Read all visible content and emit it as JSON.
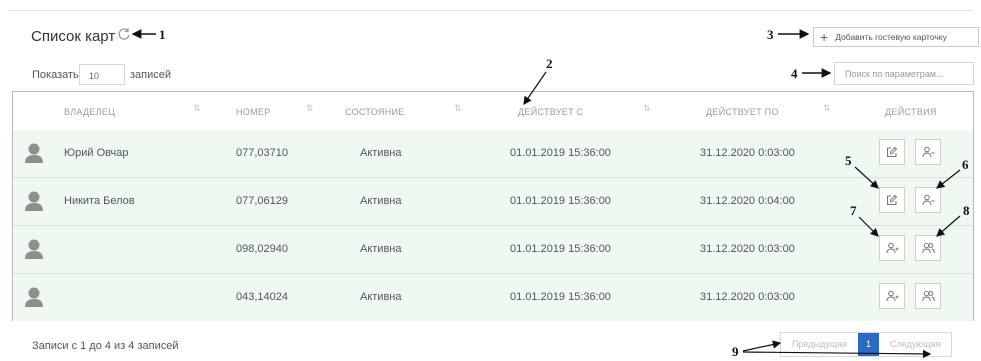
{
  "header": {
    "title": "Список карт",
    "refresh_icon": "refresh-icon",
    "add_button_label": "Добавить гостевую карточку"
  },
  "controls": {
    "show_label": "Показать",
    "length_value": "10",
    "records_label": "записей",
    "search_placeholder": "Поиск по параметрам..."
  },
  "table": {
    "columns": [
      "ВЛАДЕЛЕЦ",
      "НОМЕР",
      "СОСТОЯНИЕ",
      "ДЕЙСТВУЕТ С",
      "ДЕЙСТВУЕТ ПО",
      "ДЕЙСТВИЯ"
    ],
    "rows": [
      {
        "owner": "Юрий Овчар",
        "number": "077,03710",
        "status": "Активна",
        "from": "01.01.2019 15:36:00",
        "to": "31.12.2020 0:03:00",
        "actions": [
          "edit-icon",
          "remove-user-icon"
        ]
      },
      {
        "owner": "Никита Белов",
        "number": "077,06129",
        "status": "Активна",
        "from": "01.01.2019 15:36:00",
        "to": "31.12.2020 0:04:00",
        "actions": [
          "edit-icon",
          "remove-user-icon"
        ]
      },
      {
        "owner": "",
        "number": "098,02940",
        "status": "Активна",
        "from": "01.01.2019 15:36:00",
        "to": "31.12.2020 0:03:00",
        "actions": [
          "add-user-icon",
          "users-icon"
        ]
      },
      {
        "owner": "",
        "number": "043,14024",
        "status": "Активна",
        "from": "01.01.2019 15:36:00",
        "to": "31.12.2020 0:03:00",
        "actions": [
          "add-user-icon",
          "users-icon"
        ]
      }
    ]
  },
  "footer": {
    "info": "Записи с 1 до 4 из 4 записей",
    "prev_label": "Предыдущая",
    "page": "1",
    "next_label": "Следующая"
  },
  "annotations": [
    "1",
    "2",
    "3",
    "4",
    "5",
    "6",
    "7",
    "8",
    "9"
  ],
  "colors": {
    "row_bg": "#f0f8f2",
    "active_page": "#2a6cc4"
  }
}
